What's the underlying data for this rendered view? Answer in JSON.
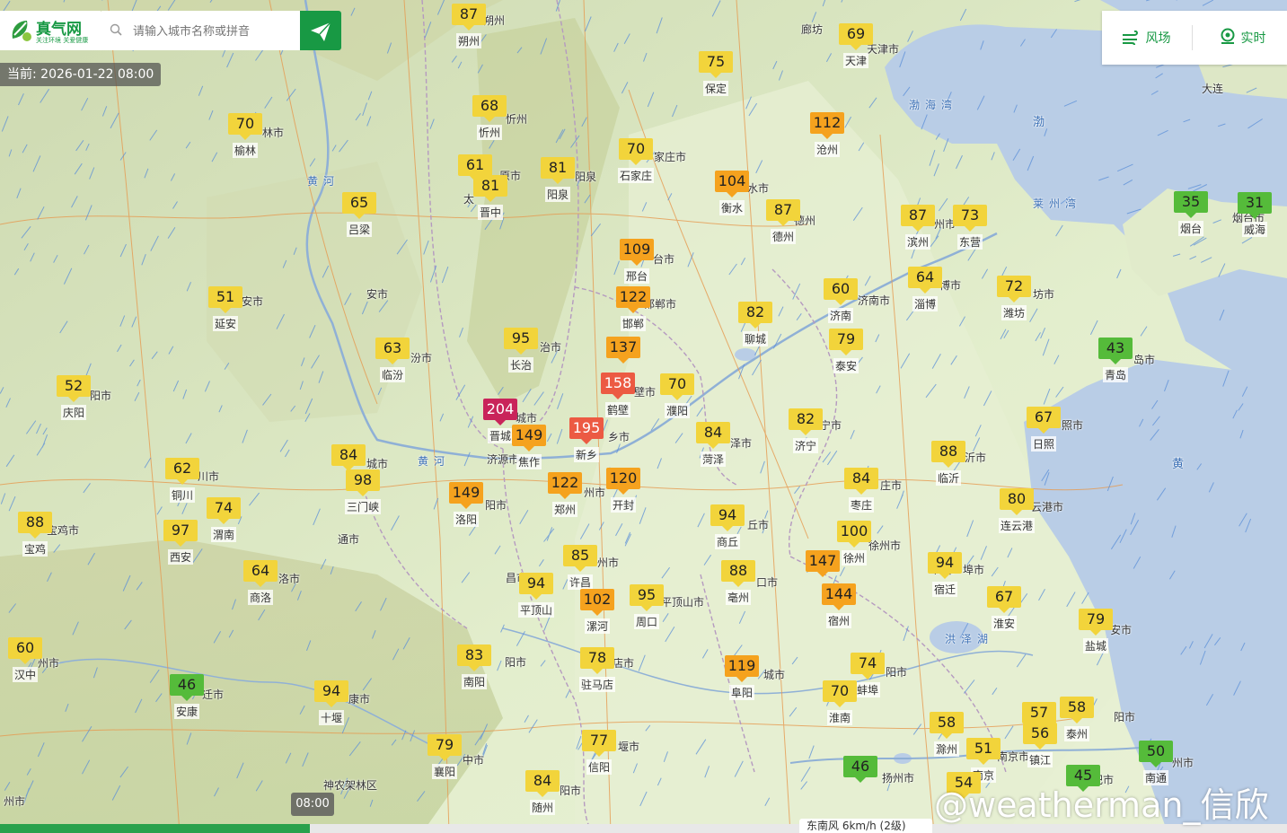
{
  "header": {
    "logo_text": "真气网",
    "logo_slogan": "关注环境 关爱健康",
    "search_placeholder": "请输入城市名称或拼音",
    "current_time": "当前: 2026-01-22 08:00"
  },
  "panel": {
    "wind_label": "风场",
    "realtime_label": "实时"
  },
  "timeline": {
    "time": "08:00",
    "wind_info": "东南风 6km/h (2级)"
  },
  "watermark": "@weatherman_信欣",
  "colors": {
    "good": "#55bb3a",
    "moderate": "#f2d43b",
    "light": "#f5a21e",
    "medium": "#ec5a43",
    "heavy": "#c9245a",
    "brand": "#189944",
    "sea": "#b9cde6"
  },
  "map_labels": [
    "渤海湾",
    "渤",
    "莱州湾",
    "黄",
    "黄河",
    "黄河",
    "洪泽湖",
    "神农架林区",
    "济源市",
    "天津市",
    "家庄市",
    "济南市",
    "南京市",
    "朔州",
    "廊坊",
    "大连",
    "林市",
    "忻州",
    "原市",
    "太",
    "阳泉",
    "水市",
    "德州",
    "州市",
    "博市",
    "坊市",
    "烟台市",
    "岛市",
    "安市",
    "台市",
    "汾市",
    "治市",
    "邯郸市",
    "安市",
    "阳市",
    "城市",
    "壁市",
    "乡市",
    "宁市",
    "照市",
    "泽市",
    "城市",
    "川市",
    "宝鸡市",
    "洛市",
    "阳市",
    "州市",
    "丘市",
    "徐州市",
    "沂市",
    "庄市",
    "云港市",
    "州市",
    "昌市",
    "平顶山市",
    "口市",
    "州市",
    "安市",
    "城市",
    "阳市",
    "店市",
    "阳市",
    "埠市",
    "迁市",
    "州市",
    "康市",
    "中市",
    "堰市",
    "阳市",
    "州市",
    "阳市",
    "扬州市",
    "州市",
    "肥市",
    "通市",
    "州市",
    "运",
    "中"
  ],
  "aqi_stations": [
    {
      "aqi": 87,
      "level": "moderate",
      "name": "朔州"
    },
    {
      "aqi": 68,
      "level": "moderate",
      "name": "忻州"
    },
    {
      "aqi": 70,
      "level": "moderate",
      "name": "榆林"
    },
    {
      "aqi": 61,
      "level": "moderate",
      "name": ""
    },
    {
      "aqi": 81,
      "level": "moderate",
      "name": "晋中"
    },
    {
      "aqi": 81,
      "level": "moderate",
      "name": "阳泉"
    },
    {
      "aqi": 70,
      "level": "moderate",
      "name": "石家庄"
    },
    {
      "aqi": 75,
      "level": "moderate",
      "name": "保定"
    },
    {
      "aqi": 69,
      "level": "moderate",
      "name": "天津"
    },
    {
      "aqi": 112,
      "level": "light",
      "name": "沧州"
    },
    {
      "aqi": 104,
      "level": "light",
      "name": "衡水"
    },
    {
      "aqi": 87,
      "level": "moderate",
      "name": "德州"
    },
    {
      "aqi": 87,
      "level": "moderate",
      "name": "滨州"
    },
    {
      "aqi": 73,
      "level": "moderate",
      "name": "东营"
    },
    {
      "aqi": 35,
      "level": "good",
      "name": "烟台"
    },
    {
      "aqi": 31,
      "level": "good",
      "name": "威海"
    },
    {
      "aqi": 65,
      "level": "moderate",
      "name": "吕梁"
    },
    {
      "aqi": 109,
      "level": "light",
      "name": "邢台"
    },
    {
      "aqi": 122,
      "level": "light",
      "name": "邯郸"
    },
    {
      "aqi": 60,
      "level": "moderate",
      "name": "济南"
    },
    {
      "aqi": 64,
      "level": "moderate",
      "name": "淄博"
    },
    {
      "aqi": 72,
      "level": "moderate",
      "name": "潍坊"
    },
    {
      "aqi": 51,
      "level": "moderate",
      "name": "延安"
    },
    {
      "aqi": 95,
      "level": "moderate",
      "name": "长治"
    },
    {
      "aqi": 137,
      "level": "light",
      "name": ""
    },
    {
      "aqi": 82,
      "level": "moderate",
      "name": "聊城"
    },
    {
      "aqi": 79,
      "level": "moderate",
      "name": "泰安"
    },
    {
      "aqi": 43,
      "level": "good",
      "name": "青岛"
    },
    {
      "aqi": 63,
      "level": "moderate",
      "name": "临汾"
    },
    {
      "aqi": 52,
      "level": "moderate",
      "name": "庆阳"
    },
    {
      "aqi": 204,
      "level": "heavy",
      "name": "晋城"
    },
    {
      "aqi": 158,
      "level": "medium",
      "name": "鹤壁"
    },
    {
      "aqi": 70,
      "level": "moderate",
      "name": "濮阳"
    },
    {
      "aqi": 195,
      "level": "medium",
      "name": "新乡"
    },
    {
      "aqi": 149,
      "level": "light",
      "name": "焦作"
    },
    {
      "aqi": 82,
      "level": "moderate",
      "name": "济宁"
    },
    {
      "aqi": 67,
      "level": "moderate",
      "name": "日照"
    },
    {
      "aqi": 84,
      "level": "moderate",
      "name": "菏泽"
    },
    {
      "aqi": 84,
      "level": "moderate",
      "name": ""
    },
    {
      "aqi": 98,
      "level": "moderate",
      "name": "三门峡"
    },
    {
      "aqi": 62,
      "level": "moderate",
      "name": "铜川"
    },
    {
      "aqi": 88,
      "level": "moderate",
      "name": "临沂"
    },
    {
      "aqi": 149,
      "level": "light",
      "name": "洛阳"
    },
    {
      "aqi": 122,
      "level": "light",
      "name": "郑州"
    },
    {
      "aqi": 120,
      "level": "light",
      "name": "开封"
    },
    {
      "aqi": 84,
      "level": "moderate",
      "name": "枣庄"
    },
    {
      "aqi": 80,
      "level": "moderate",
      "name": "连云港"
    },
    {
      "aqi": 88,
      "level": "moderate",
      "name": "宝鸡"
    },
    {
      "aqi": 74,
      "level": "moderate",
      "name": "渭南"
    },
    {
      "aqi": 97,
      "level": "moderate",
      "name": "西安"
    },
    {
      "aqi": 94,
      "level": "moderate",
      "name": "商丘"
    },
    {
      "aqi": 100,
      "level": "moderate",
      "name": "徐州"
    },
    {
      "aqi": 64,
      "level": "moderate",
      "name": "商洛"
    },
    {
      "aqi": 85,
      "level": "moderate",
      "name": "许昌"
    },
    {
      "aqi": 94,
      "level": "moderate",
      "name": "平顶山"
    },
    {
      "aqi": 88,
      "level": "moderate",
      "name": "亳州"
    },
    {
      "aqi": 147,
      "level": "light",
      "name": ""
    },
    {
      "aqi": 94,
      "level": "moderate",
      "name": "宿迁"
    },
    {
      "aqi": 102,
      "level": "light",
      "name": "漯河"
    },
    {
      "aqi": 95,
      "level": "moderate",
      "name": "周口"
    },
    {
      "aqi": 144,
      "level": "light",
      "name": "宿州"
    },
    {
      "aqi": 67,
      "level": "moderate",
      "name": "淮安"
    },
    {
      "aqi": 79,
      "level": "moderate",
      "name": "盐城"
    },
    {
      "aqi": 60,
      "level": "moderate",
      "name": "汉中"
    },
    {
      "aqi": 83,
      "level": "moderate",
      "name": "南阳"
    },
    {
      "aqi": 78,
      "level": "moderate",
      "name": "驻马店"
    },
    {
      "aqi": 74,
      "level": "moderate",
      "name": "蚌埠"
    },
    {
      "aqi": 46,
      "level": "good",
      "name": "安康"
    },
    {
      "aqi": 94,
      "level": "moderate",
      "name": "十堰"
    },
    {
      "aqi": 119,
      "level": "light",
      "name": "阜阳"
    },
    {
      "aqi": 70,
      "level": "moderate",
      "name": "淮南"
    },
    {
      "aqi": 58,
      "level": "moderate",
      "name": "滁州"
    },
    {
      "aqi": 57,
      "level": "moderate",
      "name": ""
    },
    {
      "aqi": 56,
      "level": "moderate",
      "name": "镇江"
    },
    {
      "aqi": 58,
      "level": "moderate",
      "name": "泰州"
    },
    {
      "aqi": 79,
      "level": "moderate",
      "name": "襄阳"
    },
    {
      "aqi": 77,
      "level": "moderate",
      "name": "信阳"
    },
    {
      "aqi": 51,
      "level": "moderate",
      "name": "南京"
    },
    {
      "aqi": 50,
      "level": "good",
      "name": "南通"
    },
    {
      "aqi": 84,
      "level": "moderate",
      "name": "随州"
    },
    {
      "aqi": 46,
      "level": "good",
      "name": ""
    },
    {
      "aqi": 45,
      "level": "good",
      "name": ""
    },
    {
      "aqi": 54,
      "level": "moderate",
      "name": ""
    },
    {
      "aqi": 57,
      "level": "moderate",
      "name": ""
    }
  ]
}
